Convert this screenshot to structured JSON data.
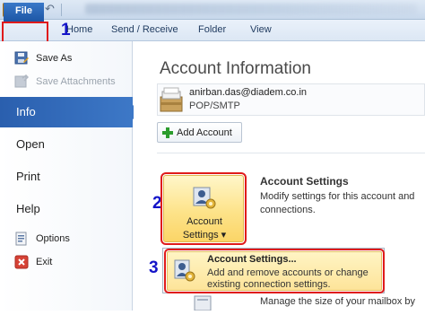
{
  "window": {
    "app_icon": "outlook-icon",
    "app_glyph": "O"
  },
  "quick_access": {
    "save_icon": "save-icon",
    "undo_icon": "undo-icon",
    "undo_glyph": "↶"
  },
  "ribbon": {
    "tabs": [
      {
        "label": "File"
      },
      {
        "label": "Home"
      },
      {
        "label": "Send / Receive"
      },
      {
        "label": "Folder"
      },
      {
        "label": "View"
      }
    ]
  },
  "steps": [
    "1",
    "2",
    "3"
  ],
  "backstage": {
    "commands": [
      {
        "label": "Save As",
        "icon": "save-as-icon"
      },
      {
        "label": "Save Attachments",
        "icon": "save-attachments-icon",
        "disabled": true
      }
    ],
    "nav": [
      "Info",
      "Open",
      "Print",
      "Help"
    ],
    "bottom_commands": [
      {
        "label": "Options",
        "icon": "options-icon"
      },
      {
        "label": "Exit",
        "icon": "exit-icon"
      }
    ]
  },
  "main": {
    "title": "Account Information",
    "account": {
      "email": "anirban.das@diadem.co.in",
      "type": "POP/SMTP"
    },
    "add_account_label": "Add Account",
    "account_settings": {
      "button_line1": "Account",
      "button_line2": "Settings",
      "title": "Account Settings",
      "description_line1": "Modify settings for this account and",
      "description_line2": "connections."
    },
    "menu_item": {
      "title": "Account Settings...",
      "description_line1": "Add and remove accounts or change",
      "description_line2": "existing connection settings."
    },
    "next_section_text": "Manage the size of your mailbox by"
  },
  "colors": {
    "file_tab": "#1d56a5",
    "info_selected": "#2a5fae",
    "highlight_red": "#e01b1b",
    "step_blue": "#1414c8",
    "button_gold": "#fde38a"
  }
}
